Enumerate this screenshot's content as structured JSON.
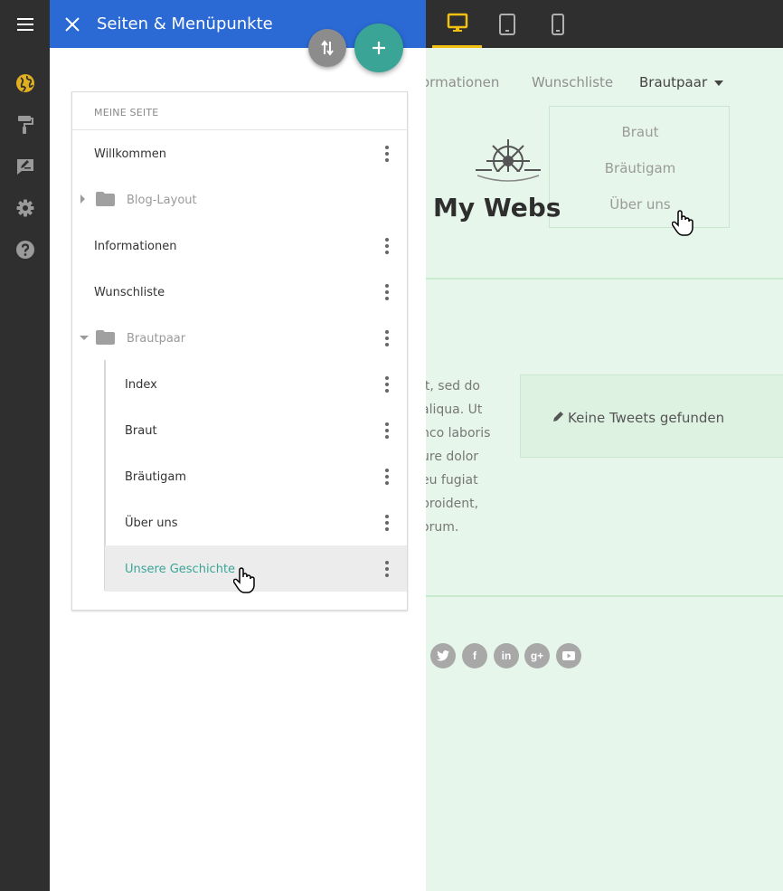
{
  "panel": {
    "title": "Seiten & Menüpunkte",
    "section_label": "MEINE SEITE",
    "items": [
      {
        "label": "Willkommen",
        "type": "page"
      },
      {
        "label": "Blog-Layout",
        "type": "folder",
        "expanded": false
      },
      {
        "label": "Informationen",
        "type": "page"
      },
      {
        "label": "Wunschliste",
        "type": "page"
      },
      {
        "label": "Brautpaar",
        "type": "folder",
        "expanded": true
      },
      {
        "label": "Index",
        "type": "subpage"
      },
      {
        "label": "Braut",
        "type": "subpage"
      },
      {
        "label": "Bräutigam",
        "type": "subpage"
      },
      {
        "label": "Über uns",
        "type": "subpage"
      },
      {
        "label": "Unsere Geschichte",
        "type": "subpage",
        "selected": true
      }
    ]
  },
  "devices": [
    "desktop-icon",
    "tablet-icon",
    "phone-icon"
  ],
  "rail_icons": [
    "globe-icon",
    "paint-roller-icon",
    "edit-icon",
    "settings-gear-icon",
    "help-icon"
  ],
  "site": {
    "nav": [
      "ormationen",
      "Wunschliste",
      "Brautpaar"
    ],
    "dropdown": [
      "Braut",
      "Bräutigam",
      "Über uns"
    ],
    "title": "My Webs",
    "lorem_lines": [
      "it, sed do",
      "aliqua. Ut",
      "nco laboris",
      "ure dolor",
      "eu fugiat",
      "proident,",
      "orum."
    ],
    "tweets": "Keine Tweets gefunden",
    "social": [
      "twitter-icon",
      "facebook-icon",
      "linkedin-icon",
      "google-plus-icon",
      "youtube-icon"
    ]
  },
  "colors": {
    "topbar": "#2f2f2f",
    "panel_header": "#2b6ad5",
    "accent_teal": "#3aa597",
    "device_active": "#f2c010",
    "site_bg": "#e7f6ea"
  }
}
